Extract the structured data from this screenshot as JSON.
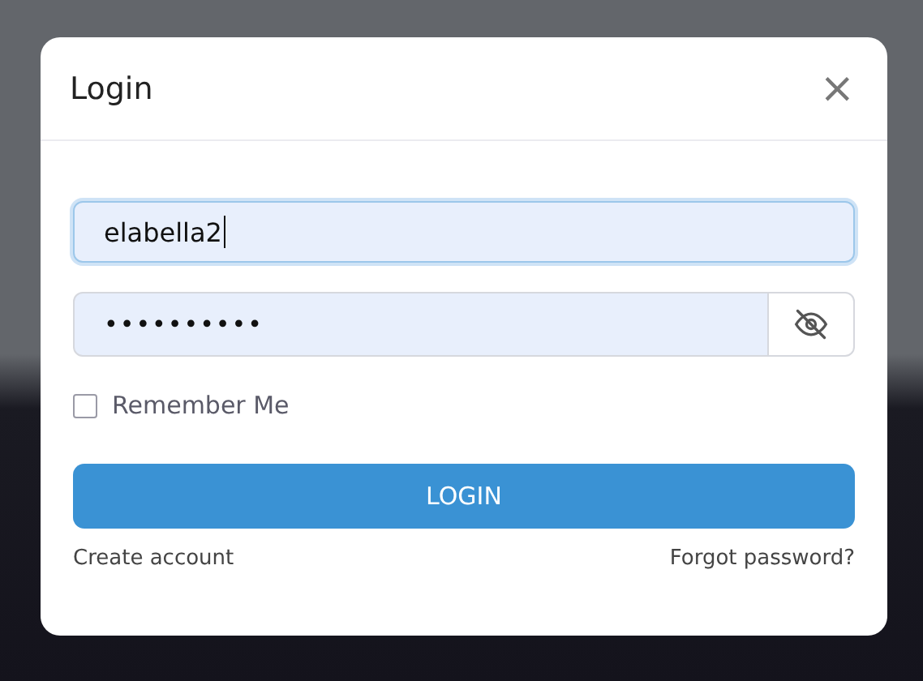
{
  "dialog": {
    "title": "Login",
    "close_icon": "×"
  },
  "username": {
    "value": "elabella2",
    "focused": true
  },
  "password": {
    "masked_value": "••••••••••",
    "visible": false
  },
  "remember_me": {
    "label": "Remember Me",
    "checked": false
  },
  "login_button": {
    "label": "LOGIN"
  },
  "links": [
    {
      "label": "Create account"
    },
    {
      "label": "Forgot password?"
    }
  ]
}
